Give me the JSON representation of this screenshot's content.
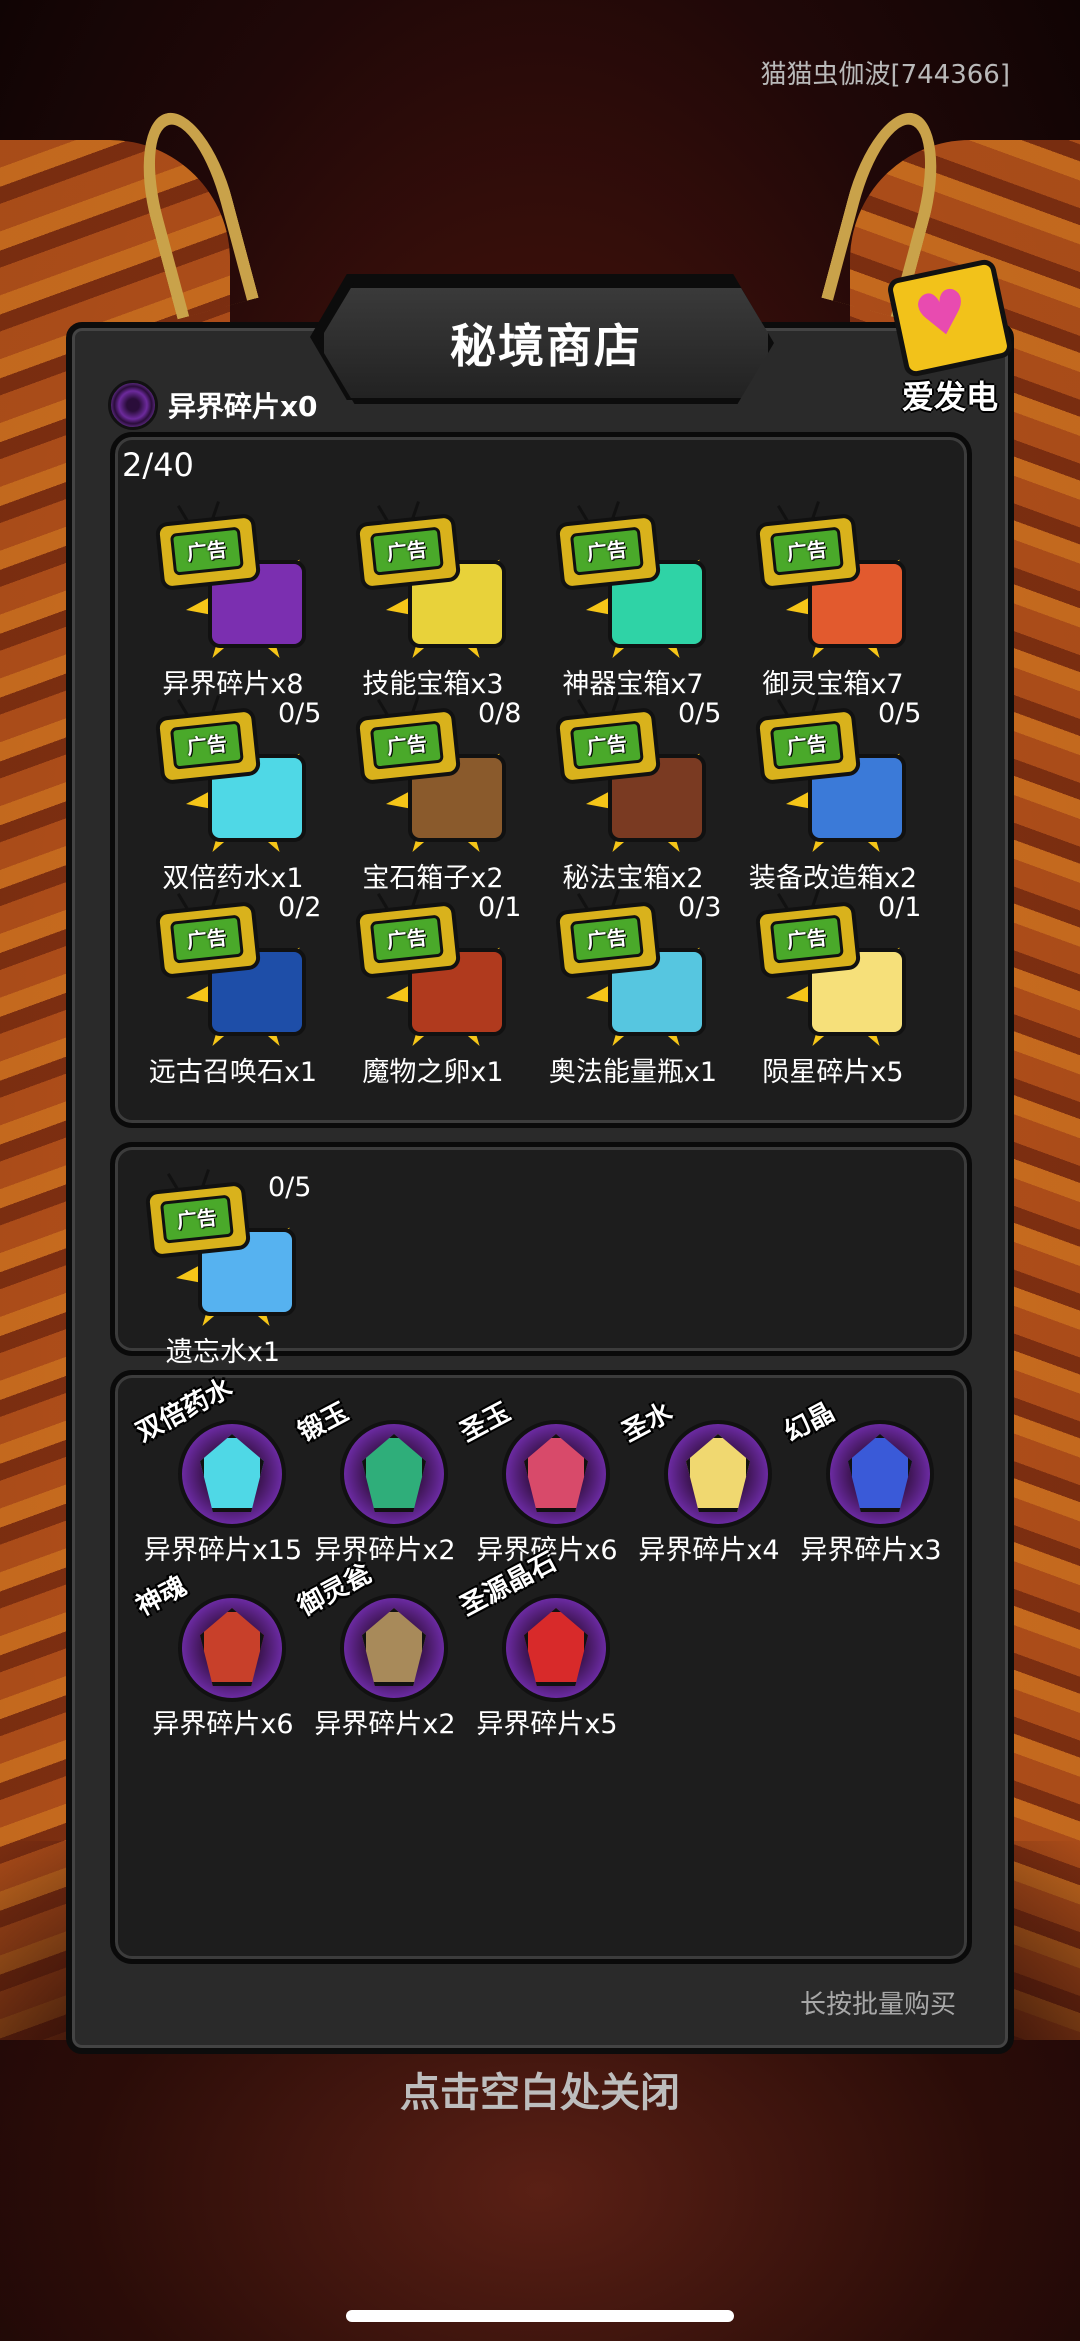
{
  "header": {
    "user_tag": "猫猫虫伽波[744366]"
  },
  "shop": {
    "title": "秘境商店",
    "love_button_label": "爱发电",
    "currency_text": "异界碎片x0",
    "ad_counter": "2/40",
    "ad_badge_text": "广告",
    "ad_items": [
      {
        "name": "异界碎片x8",
        "qty": "",
        "color": "#7b2fb0"
      },
      {
        "name": "技能宝箱x3",
        "qty": "",
        "color": "#e8d23a"
      },
      {
        "name": "神器宝箱x7",
        "qty": "",
        "color": "#2fd3a6"
      },
      {
        "name": "御灵宝箱x7",
        "qty": "",
        "color": "#e25a2e"
      },
      {
        "name": "双倍药水x1",
        "qty": "0/5",
        "color": "#4fd8e6"
      },
      {
        "name": "宝石箱子x2",
        "qty": "0/8",
        "color": "#8a5a2c"
      },
      {
        "name": "秘法宝箱x2",
        "qty": "0/5",
        "color": "#7a3a22"
      },
      {
        "name": "装备改造箱x2",
        "qty": "0/5",
        "color": "#3b7ad8"
      },
      {
        "name": "远古召唤石x1",
        "qty": "0/2",
        "color": "#1e4ea8"
      },
      {
        "name": "魔物之卵x1",
        "qty": "0/1",
        "color": "#b03a1e"
      },
      {
        "name": "奥法能量瓶x1",
        "qty": "0/3",
        "color": "#56c6e0"
      },
      {
        "name": "陨星碎片x5",
        "qty": "0/1",
        "color": "#f6e07a"
      }
    ],
    "single_item": {
      "name": "遗忘水x1",
      "qty": "0/5",
      "color": "#56b2f0"
    },
    "exchange_items": [
      {
        "label": "双倍药水",
        "cost": "异界碎片x15",
        "color": "#4fd8e6"
      },
      {
        "label": "锻玉",
        "cost": "异界碎片x2",
        "color": "#2fae7a"
      },
      {
        "label": "圣玉",
        "cost": "异界碎片x6",
        "color": "#d84a6a"
      },
      {
        "label": "圣水",
        "cost": "异界碎片x4",
        "color": "#f0d870"
      },
      {
        "label": "幻晶",
        "cost": "异界碎片x3",
        "color": "#3a5ad8"
      },
      {
        "label": "神魂",
        "cost": "异界碎片x6",
        "color": "#c8402a"
      },
      {
        "label": "御灵瓮",
        "cost": "异界碎片x2",
        "color": "#a88a5a"
      },
      {
        "label": "圣源晶石",
        "cost": "异界碎片x5",
        "color": "#d82a2a"
      }
    ],
    "bulk_hint": "长按批量购买",
    "close_hint": "点击空白处关闭"
  }
}
